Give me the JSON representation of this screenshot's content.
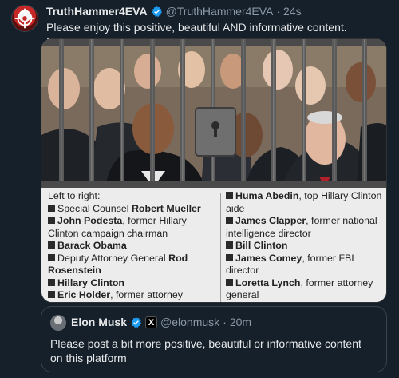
{
  "post": {
    "display_name": "TruthHammer4EVA",
    "handle": "@TruthHammer4EVA",
    "separator": "·",
    "time": "24s",
    "text": "Please enjoy this positive, beautiful AND informative content. NCSWIC."
  },
  "image": {
    "caption_intro": "Left to right:",
    "left_items": [
      {
        "prefix": "Special Counsel ",
        "name": "Robert Mueller",
        "suffix": ""
      },
      {
        "prefix": "",
        "name": "John Podesta",
        "suffix": ", former Hillary Clinton campaign chairman"
      },
      {
        "prefix": "",
        "name": "Barack Obama",
        "suffix": ""
      },
      {
        "prefix": "Deputy Attorney General ",
        "name": "Rod Rosenstein",
        "suffix": ""
      },
      {
        "prefix": "",
        "name": "Hillary Clinton",
        "suffix": ""
      },
      {
        "prefix": "",
        "name": "Eric Holder",
        "suffix": ", former attorney general"
      }
    ],
    "right_items": [
      {
        "prefix": "",
        "name": "Huma Abedin",
        "suffix": ", top Hillary Clinton aide"
      },
      {
        "prefix": "",
        "name": "James Clapper",
        "suffix": ", former national intelligence director"
      },
      {
        "prefix": "",
        "name": "Bill Clinton",
        "suffix": ""
      },
      {
        "prefix": "",
        "name": "James Comey",
        "suffix": ", former FBI director"
      },
      {
        "prefix": "",
        "name": "Loretta Lynch",
        "suffix": ", former attorney general"
      }
    ]
  },
  "quote": {
    "display_name": "Elon Musk",
    "handle": "@elonmusk",
    "separator": "·",
    "time": "20m",
    "badge_letter": "X",
    "text": "Please post a bit more positive, beautiful or informative content on this platform"
  },
  "colors": {
    "background": "#15202b",
    "verified_blue": "#1d9bf0",
    "text_primary": "#e7e9ea",
    "text_secondary": "#8b98a5",
    "border": "#38444d"
  },
  "icons": {
    "verified": "verified-badge-icon",
    "affiliate": "x-affiliate-badge-icon",
    "lock": "padlock-icon"
  }
}
